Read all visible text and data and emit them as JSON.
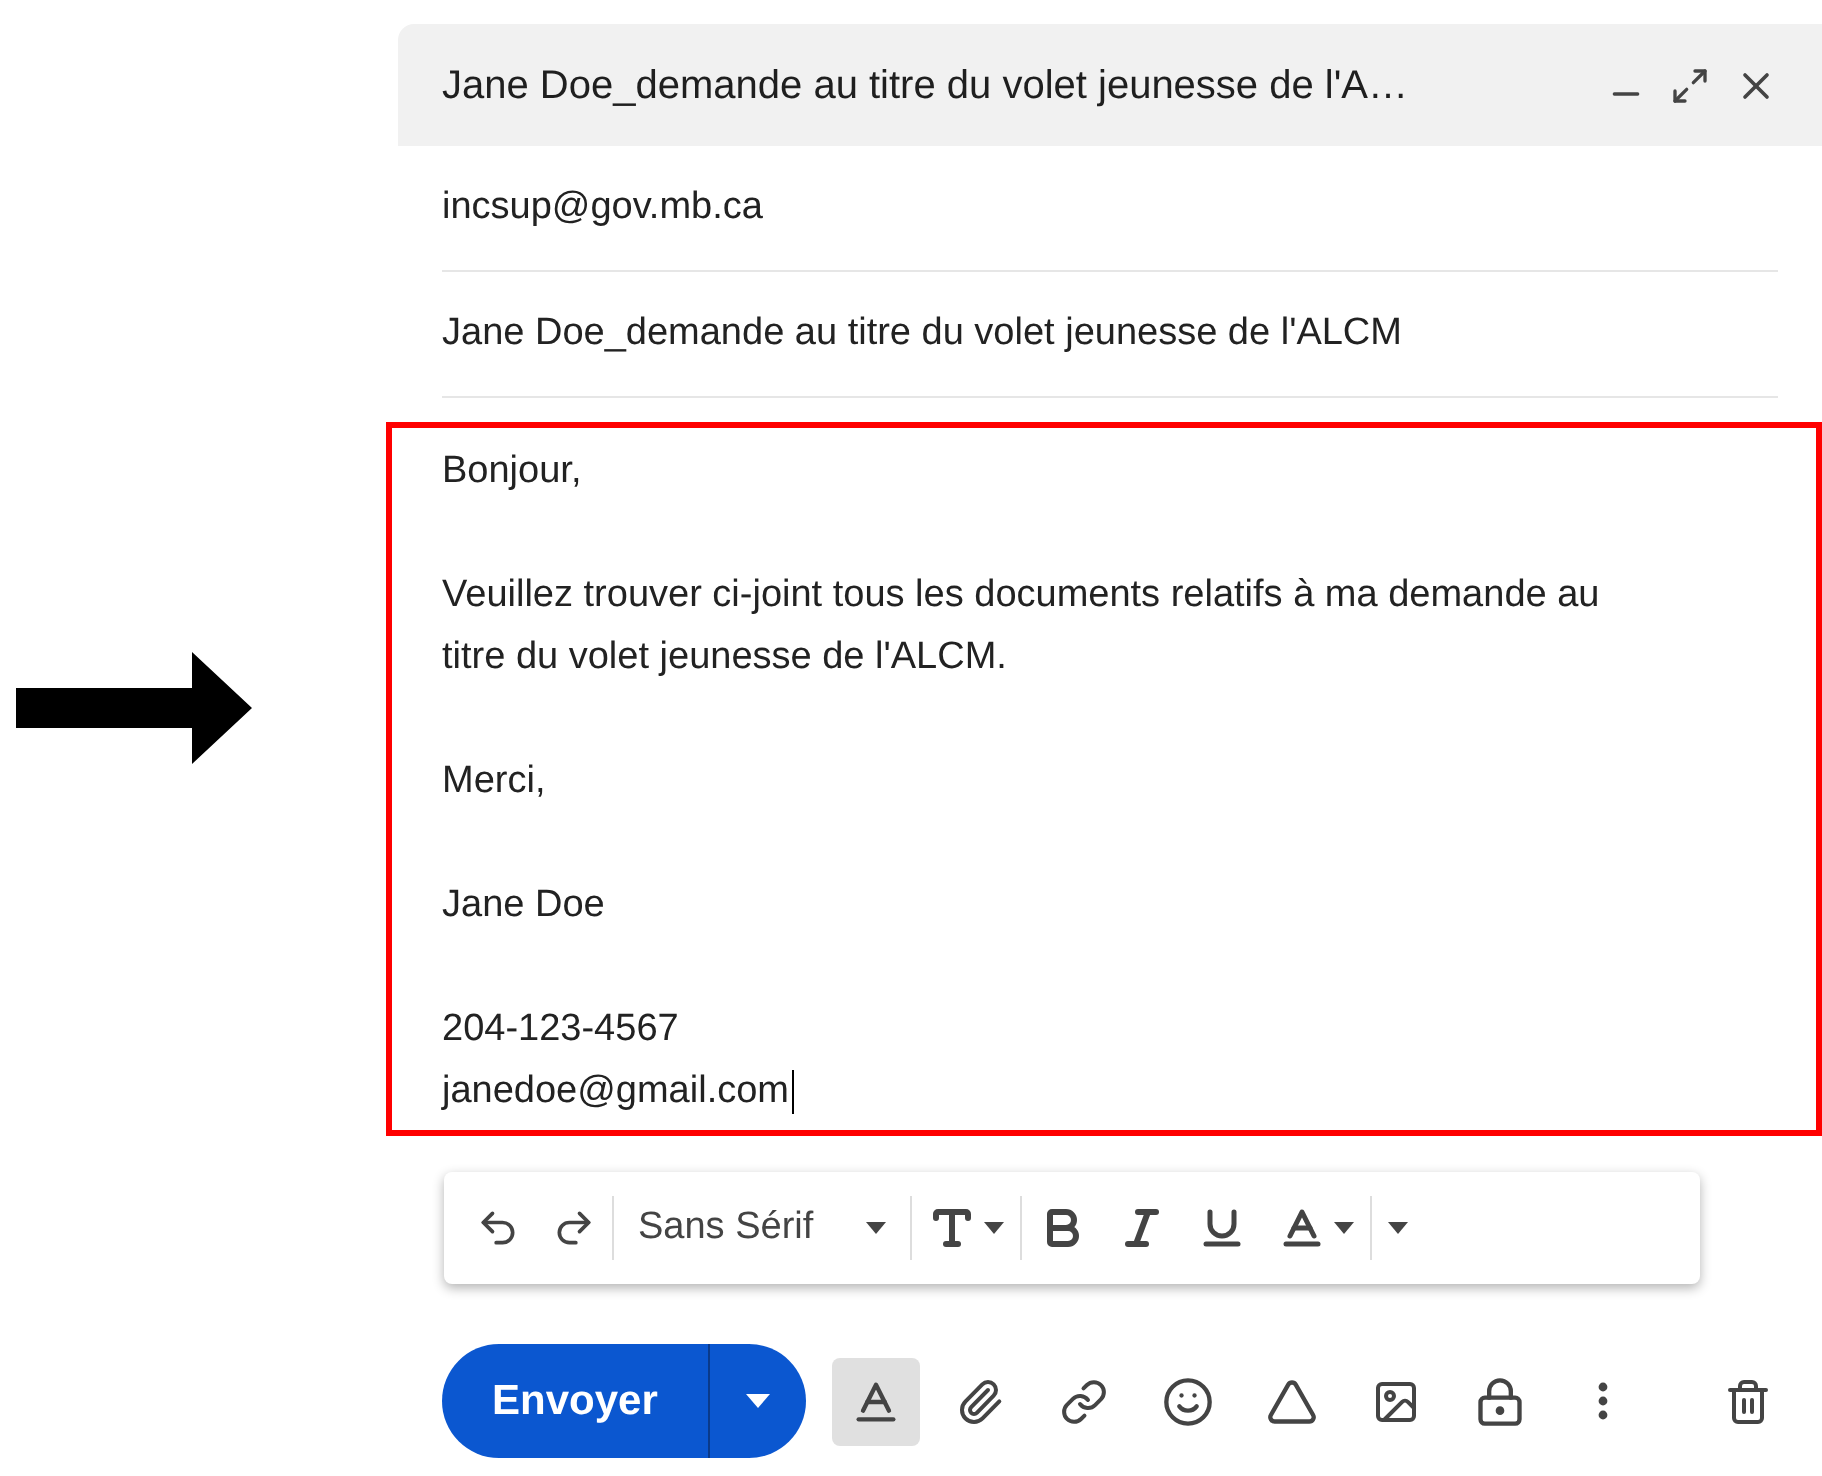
{
  "window": {
    "title": "Jane Doe_demande au titre du volet jeunesse de l'A…"
  },
  "recipient": "incsup@gov.mb.ca",
  "subject": "Jane Doe_demande au titre du volet jeunesse de l'ALCM",
  "body": {
    "highlighted": true,
    "paragraphs": [
      [
        "Bonjour,"
      ],
      [
        "Veuillez trouver ci-joint tous les documents relatifs à ma demande au titre du volet jeunesse de l'ALCM."
      ],
      [
        "Merci,"
      ],
      [
        "Jane Doe"
      ],
      [
        "204-123-4567",
        "janedoe@gmail.com"
      ]
    ]
  },
  "format_toolbar": {
    "font": "Sans Sérif"
  },
  "send_button": "Envoyer",
  "formatting_toggle": {
    "selected": true
  }
}
